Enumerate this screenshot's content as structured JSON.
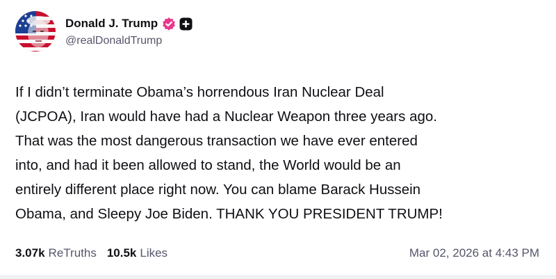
{
  "author": {
    "display_name": "Donald J. Trump",
    "handle": "@realDonaldTrump",
    "verified_icon": "verified-badge-icon",
    "plus_icon": "plus-badge-icon",
    "brand_color": "#e8378a"
  },
  "post": {
    "text": "If I didn’t terminate Obama’s horrendous Iran Nuclear Deal\n(JCPOA), Iran would have had a Nuclear Weapon three years ago.\nThat was the most dangerous transaction we have ever entered\ninto, and had it been allowed to stand, the World would be an\nentirely different place right now. You can blame Barack Hussein\nObama, and Sleepy Joe Biden. THANK YOU PRESIDENT TRUMP!"
  },
  "stats": {
    "retruths_count": "3.07k",
    "retruths_label": "ReTruths",
    "likes_count": "10.5k",
    "likes_label": "Likes"
  },
  "timestamp": "Mar 02, 2026 at 4:43 PM"
}
